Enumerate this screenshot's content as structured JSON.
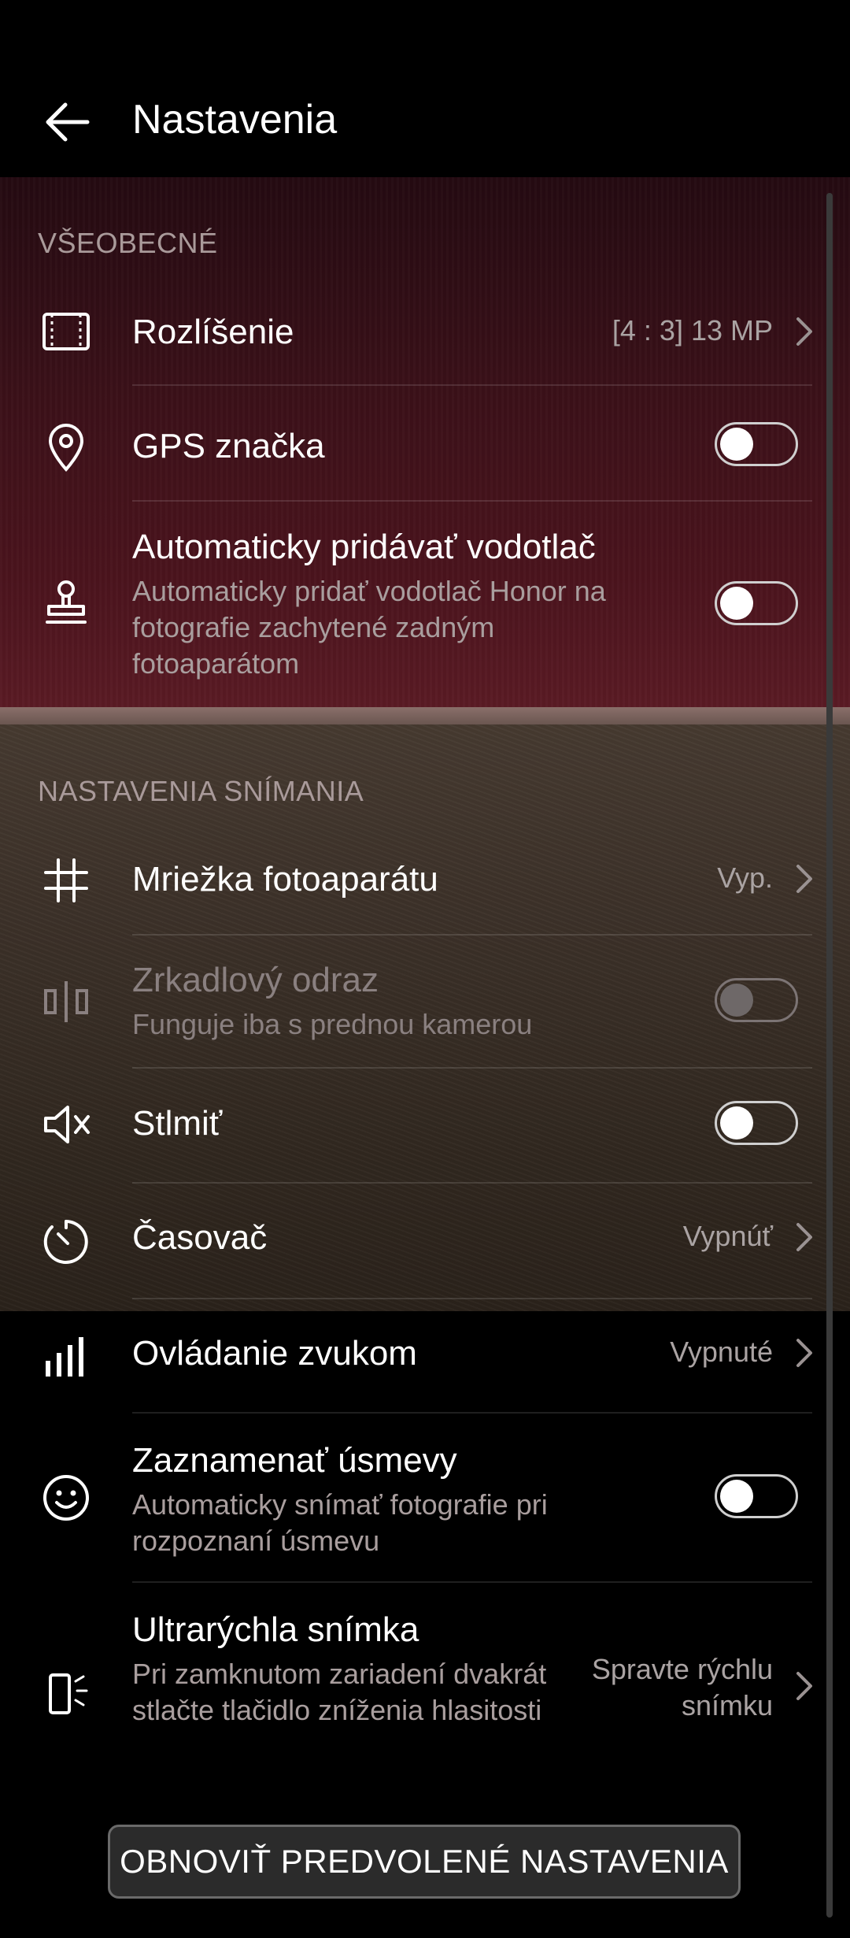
{
  "header": {
    "title": "Nastavenia",
    "back_icon": "arrow-left-icon"
  },
  "sections": {
    "general": {
      "label": "VŠEOBECNÉ"
    },
    "capture": {
      "label": "NASTAVENIA SNÍMANIA"
    }
  },
  "items": {
    "resolution": {
      "title": "Rozlíšenie",
      "value": "[4 : 3] 13 MP",
      "icon": "resolution-frame-icon"
    },
    "gps": {
      "title": "GPS značka",
      "toggle_on": false,
      "icon": "location-pin-icon"
    },
    "watermark": {
      "title": "Automaticky pridávať vodotlač",
      "subtitle": "Automaticky pridať vodotlač Honor na fotografie zachytené zadným fotoaparátom",
      "toggle_on": false,
      "icon": "stamp-icon"
    },
    "grid": {
      "title": "Mriežka fotoaparátu",
      "value": "Vyp.",
      "icon": "grid-hash-icon"
    },
    "mirror": {
      "title": "Zrkadlový odraz",
      "subtitle": "Funguje iba s prednou kamerou",
      "toggle_on": false,
      "disabled": true,
      "icon": "mirror-icon"
    },
    "mute": {
      "title": "Stlmiť",
      "toggle_on": false,
      "icon": "speaker-mute-icon"
    },
    "timer": {
      "title": "Časovač",
      "value": "Vypnúť",
      "icon": "timer-icon"
    },
    "voice": {
      "title": "Ovládanie zvukom",
      "value": "Vypnuté",
      "icon": "audio-bars-icon"
    },
    "smile": {
      "title": "Zaznamenať úsmevy",
      "subtitle": "Automaticky snímať fotografie pri rozpoznaní úsmevu",
      "toggle_on": false,
      "icon": "smile-face-icon"
    },
    "ultra": {
      "title": "Ultrarýchla snímka",
      "subtitle": "Pri zamknutom zariadení dvakrát stlačte tlačidlo zníženia hlasitosti",
      "value": "Spravte rýchlu snímku",
      "icon": "phone-snapshot-icon"
    }
  },
  "reset_button": {
    "label": "OBNOVIŤ PREDVOLENÉ NASTAVENIA"
  },
  "colors": {
    "background": "#000000",
    "section_header": "#a99a9a",
    "subtext": "#a99e9e"
  }
}
